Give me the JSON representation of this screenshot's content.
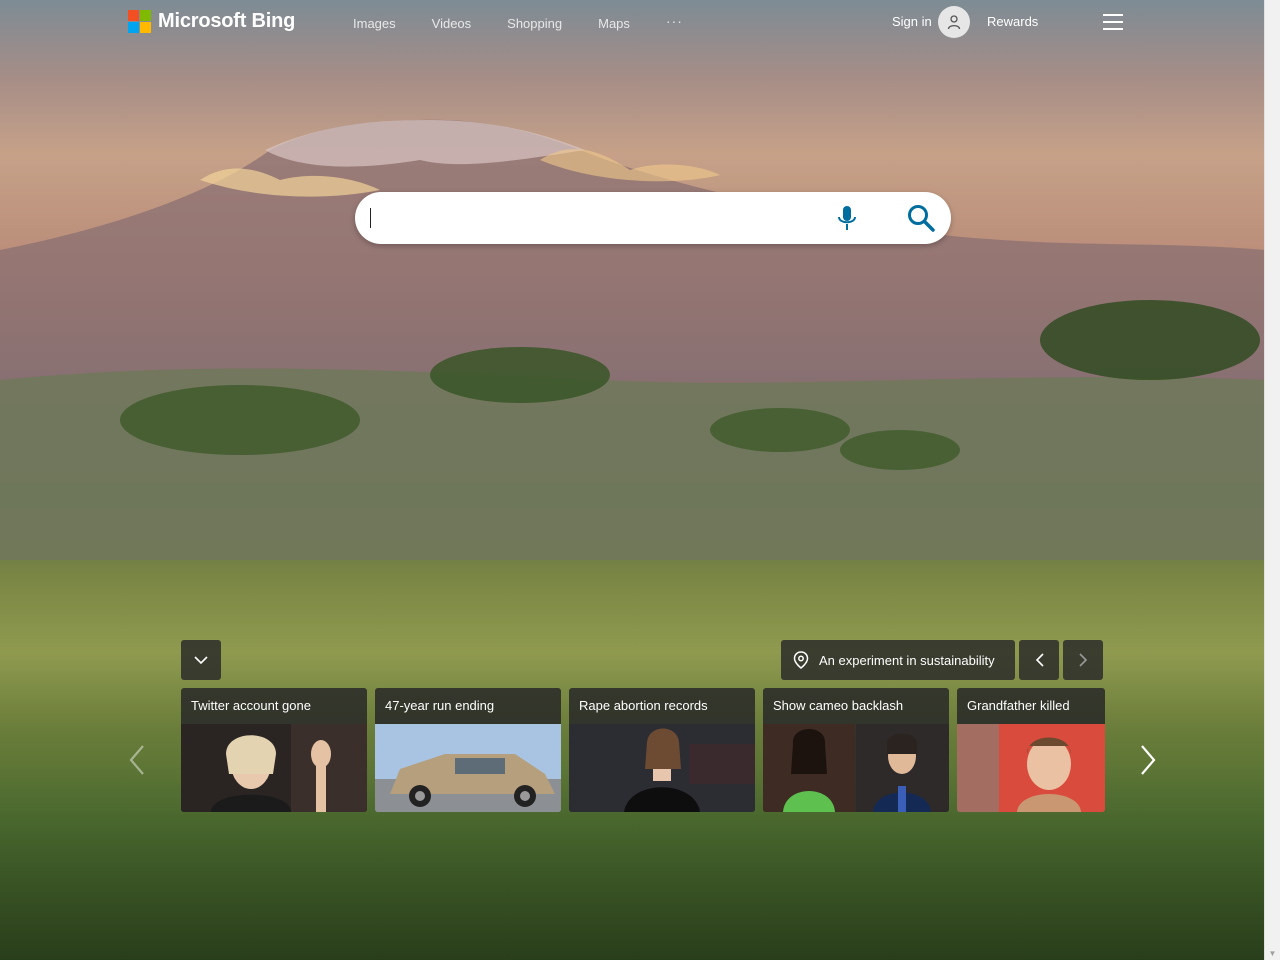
{
  "brand": {
    "name": "Microsoft Bing",
    "colors": [
      "#f25022",
      "#7fba00",
      "#00a4ef",
      "#ffb900"
    ]
  },
  "nav": {
    "items": [
      {
        "label": "Images"
      },
      {
        "label": "Videos"
      },
      {
        "label": "Shopping"
      },
      {
        "label": "Maps"
      }
    ],
    "more_label": "···"
  },
  "account": {
    "signin_label": "Sign in",
    "rewards_label": "Rewards"
  },
  "search": {
    "value": "",
    "placeholder": "",
    "accent": "#006d9f"
  },
  "carousel": {
    "location_label": "An experiment in sustainability",
    "cards": [
      {
        "title": "Twitter account gone"
      },
      {
        "title": "47-year run ending"
      },
      {
        "title": "Rape abortion records"
      },
      {
        "title": "Show cameo backlash"
      },
      {
        "title": "Grandfather killed"
      }
    ]
  },
  "icons": {
    "menu": "hamburger-icon",
    "avatar": "user-icon",
    "mic": "microphone-icon",
    "search": "magnifier-icon",
    "collapse": "chevron-down-icon",
    "location": "location-pin-icon"
  }
}
